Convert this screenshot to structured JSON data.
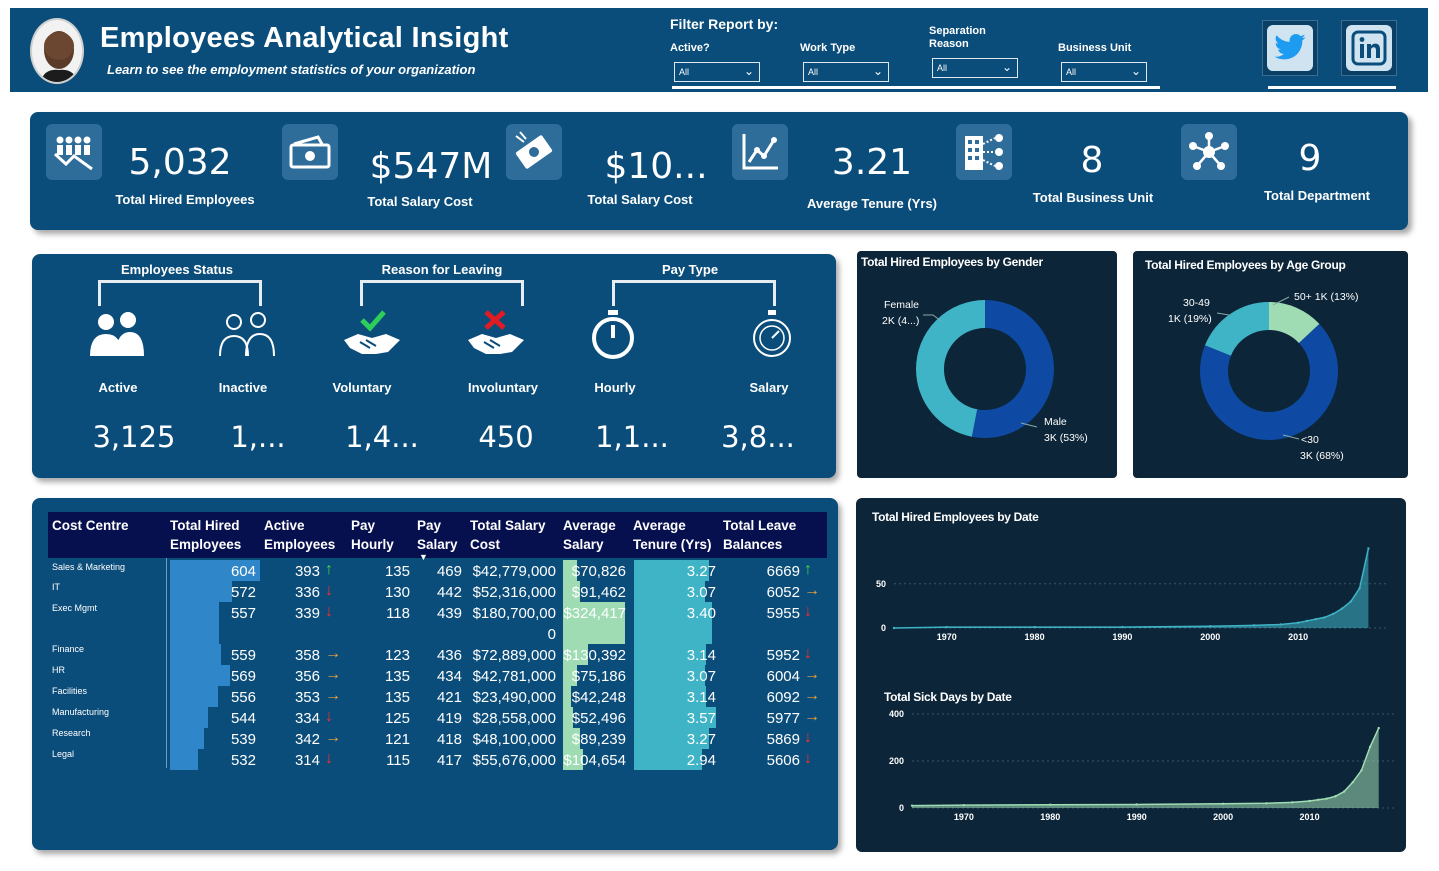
{
  "header": {
    "title": "Employees Analytical Insight",
    "subtitle": "Learn to see the employment statistics of your organization",
    "filter_title": "Filter Report by:",
    "filters": [
      {
        "label": "Active?",
        "value": "All"
      },
      {
        "label": "Work Type",
        "value": "All"
      },
      {
        "label": "Separation Reason",
        "value": "All"
      },
      {
        "label": "Business Unit",
        "value": "All"
      }
    ],
    "social": [
      "twitter-icon",
      "linkedin-icon"
    ]
  },
  "kpis": [
    {
      "value": "5,032",
      "label": "Total Hired Employees",
      "icon": "people-chart-icon"
    },
    {
      "value": "$547M",
      "label": "Total Salary Cost",
      "icon": "cash-icon"
    },
    {
      "value": "$10...",
      "label": "Total Salary Cost",
      "icon": "money-flying-icon"
    },
    {
      "value": "3.21",
      "label": "Average Tenure (Yrs)",
      "icon": "line-chart-icon"
    },
    {
      "value": "8",
      "label": "Total Business Unit",
      "icon": "building-network-icon"
    },
    {
      "value": "9",
      "label": "Total Department",
      "icon": "network-icon"
    }
  ],
  "status": {
    "groups": [
      "Employees Status",
      "Reason for Leaving",
      "Pay Type"
    ],
    "items": [
      {
        "label": "Active",
        "value": "3,125"
      },
      {
        "label": "Inactive",
        "value": "1,..."
      },
      {
        "label": "Voluntary",
        "value": "1,4..."
      },
      {
        "label": "Involuntary",
        "value": "450"
      },
      {
        "label": "Hourly",
        "value": "1,1..."
      },
      {
        "label": "Salary",
        "value": "3,8..."
      }
    ]
  },
  "gender_chart": {
    "title": "Total Hired Employees by Gender",
    "female_label": "Female",
    "female_value": "2K (4...)",
    "male_label": "Male",
    "male_value": "3K (53%)",
    "female_pct": 47,
    "male_pct": 53,
    "colors": {
      "female": "#3fb4c6",
      "male": "#0e4aa3"
    }
  },
  "age_chart": {
    "title": "Total Hired Employees by Age Group",
    "seg1_label": "50+ 1K (13%)",
    "seg2_label": "30-49",
    "seg2_value": "1K (19%)",
    "seg3_label": "<30",
    "seg3_value": "3K (68%)",
    "pcts": [
      13,
      19,
      68
    ],
    "colors": [
      "#9fdcb3",
      "#3fb4c6",
      "#0e4aa3"
    ]
  },
  "table": {
    "headers": {
      "cost_centre": "Cost Centre",
      "hired": [
        "Total Hired",
        "Employees"
      ],
      "active": [
        "Active",
        "Employees"
      ],
      "hourly": [
        "Pay",
        "Hourly"
      ],
      "salary": [
        "Pay",
        "Salary"
      ],
      "cost": [
        "Total Salary",
        "Cost"
      ],
      "avg_salary": [
        "Average",
        "Salary"
      ],
      "tenure": [
        "Average",
        "Tenure (Yrs)"
      ],
      "leave": [
        "Total Leave",
        "Balances"
      ]
    },
    "rows": [
      {
        "cc": "Sales & Marketing",
        "hired": "604",
        "active": "393",
        "a_dir": "up",
        "hourly": "135",
        "salary": "469",
        "cost": "$42,779,000",
        "avg": "$70,826",
        "tenure": "3.27",
        "leave": "6669",
        "l_dir": "up"
      },
      {
        "cc": "IT",
        "hired": "572",
        "active": "336",
        "a_dir": "down",
        "hourly": "130",
        "salary": "442",
        "cost": "$52,316,000",
        "avg": "$91,462",
        "tenure": "3.07",
        "leave": "6052",
        "l_dir": "right"
      },
      {
        "cc": "Exec Mgmt",
        "hired": "557",
        "active": "339",
        "a_dir": "down",
        "hourly": "118",
        "salary": "439",
        "cost": "$180,700,00",
        "cost2": "0",
        "avg": "$324,417",
        "tenure": "3.40",
        "leave": "5955",
        "l_dir": "down"
      },
      {
        "cc": "Finance",
        "hired": "559",
        "active": "358",
        "a_dir": "right",
        "hourly": "123",
        "salary": "436",
        "cost": "$72,889,000",
        "avg": "$130,392",
        "tenure": "3.14",
        "leave": "5952",
        "l_dir": "down"
      },
      {
        "cc": "HR",
        "hired": "569",
        "active": "356",
        "a_dir": "right",
        "hourly": "135",
        "salary": "434",
        "cost": "$42,781,000",
        "avg": "$75,186",
        "tenure": "3.07",
        "leave": "6004",
        "l_dir": "right"
      },
      {
        "cc": "Facilities",
        "hired": "556",
        "active": "353",
        "a_dir": "right",
        "hourly": "135",
        "salary": "421",
        "cost": "$23,490,000",
        "avg": "$42,248",
        "tenure": "3.14",
        "leave": "6092",
        "l_dir": "right"
      },
      {
        "cc": "Manufacturing",
        "hired": "544",
        "active": "334",
        "a_dir": "down",
        "hourly": "125",
        "salary": "419",
        "cost": "$28,558,000",
        "avg": "$52,496",
        "tenure": "3.57",
        "leave": "5977",
        "l_dir": "right"
      },
      {
        "cc": "Research",
        "hired": "539",
        "active": "342",
        "a_dir": "right",
        "hourly": "121",
        "salary": "418",
        "cost": "$48,100,000",
        "avg": "$89,239",
        "tenure": "3.27",
        "leave": "5869",
        "l_dir": "down"
      },
      {
        "cc": "Legal",
        "hired": "532",
        "active": "314",
        "a_dir": "down",
        "hourly": "115",
        "salary": "417",
        "cost": "$55,676,000",
        "avg": "$104,654",
        "tenure": "2.94",
        "leave": "5606",
        "l_dir": "down"
      }
    ]
  },
  "chart_data": [
    {
      "type": "area",
      "title": "Total Hired Employees by Date",
      "xticks": [
        "1970",
        "1980",
        "1990",
        "2000",
        "2010"
      ],
      "yticks": [
        "0",
        "50"
      ],
      "ylim": [
        0,
        95
      ],
      "x": [
        1964,
        1970,
        1980,
        1990,
        2000,
        2005,
        2008,
        2010,
        2011,
        2012,
        2013,
        2014,
        2015,
        2016,
        2017,
        2018
      ],
      "values": [
        0,
        1,
        1,
        1,
        2,
        3,
        4,
        6,
        8,
        10,
        12,
        16,
        22,
        30,
        45,
        90
      ],
      "color": "#3fb4c6"
    },
    {
      "type": "area",
      "title": "Total Sick Days by Date",
      "xticks": [
        "1970",
        "1980",
        "1990",
        "2000",
        "2010"
      ],
      "yticks": [
        "0",
        "200",
        "400"
      ],
      "ylim": [
        0,
        400
      ],
      "x": [
        1964,
        1970,
        1980,
        1990,
        2000,
        2005,
        2008,
        2010,
        2011,
        2012,
        2013,
        2014,
        2015,
        2016,
        2017,
        2018
      ],
      "values": [
        10,
        12,
        14,
        15,
        18,
        20,
        24,
        30,
        35,
        40,
        50,
        70,
        110,
        160,
        260,
        340
      ],
      "color": "#9fdcb3"
    }
  ]
}
